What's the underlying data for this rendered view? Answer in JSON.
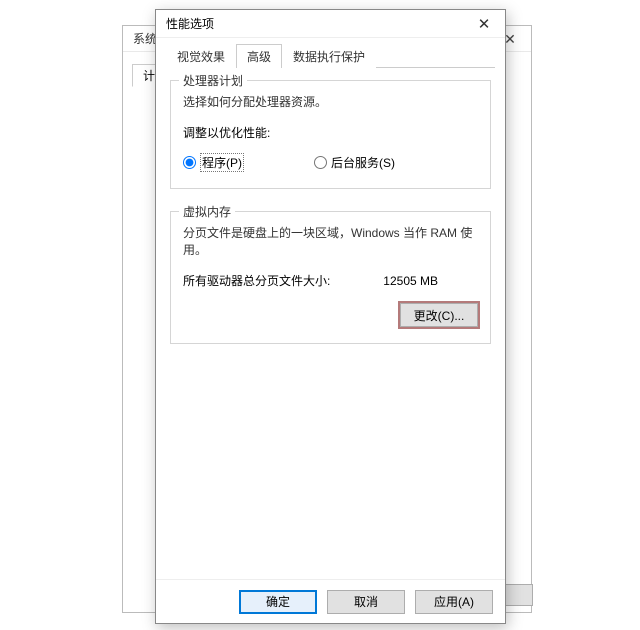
{
  "background_dialog": {
    "title_fragment": "系统",
    "tab_fragment": "计",
    "close_glyph": "✕"
  },
  "dialog": {
    "title": "性能选项",
    "close_glyph": "✕",
    "tabs": {
      "visual": "视觉效果",
      "advanced": "高级",
      "dep": "数据执行保护"
    },
    "processor": {
      "legend": "处理器计划",
      "desc": "选择如何分配处理器资源。",
      "adjust_label": "调整以优化性能:",
      "radio_programs": "程序(P)",
      "radio_services": "后台服务(S)"
    },
    "vm": {
      "legend": "虚拟内存",
      "desc": "分页文件是硬盘上的一块区域，Windows 当作 RAM 使用。",
      "total_label": "所有驱动器总分页文件大小:",
      "total_value": "12505 MB",
      "change_label": "更改(C)..."
    },
    "footer": {
      "ok": "确定",
      "cancel": "取消",
      "apply": "应用(A)"
    }
  }
}
